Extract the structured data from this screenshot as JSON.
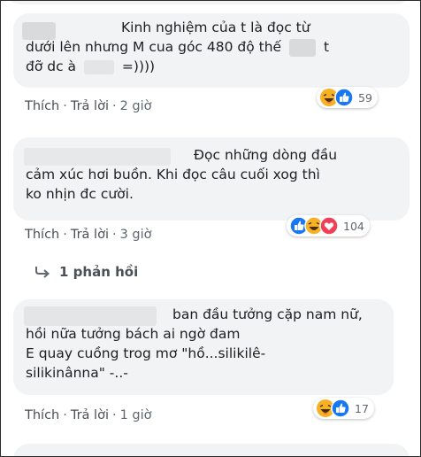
{
  "comments": [
    {
      "line1": "Kinh nghiệm của t là đọc từ",
      "line2_pre": "dưới lên nhưng M cua góc 480 độ thế",
      "line2_post": "t",
      "line3_pre": "đỡ dc à",
      "line3_post": "=))))",
      "like": "Thích",
      "reply": "Trả lời",
      "time": "2 giờ",
      "reaction_count": "59"
    },
    {
      "line1": "Đọc những dòng đầu",
      "line2": "cảm xúc hơi buồn. Khi đọc câu cuối xog thì",
      "line3": "ko nhịn đc cười.",
      "like": "Thích",
      "reply": "Trả lời",
      "time": "3 giờ",
      "reaction_count": "104"
    },
    {
      "line1": "ban đầu tưởng cặp nam nữ,",
      "line2": "hồi nữa tưởng bách ai ngờ đam",
      "line3": "E quay cuồng trog mơ \"hồ...silikilê-",
      "line4": "silikinânna\" -..-",
      "like": "Thích",
      "reply": "Trả lời",
      "time": "1 giờ",
      "reaction_count": "17"
    }
  ],
  "replies_label": "1 phản hồi",
  "separator": "·",
  "colors": {
    "bubble": "#f2f3f5",
    "like_blue": "#1877f2",
    "haha_yellow": "#f7b125",
    "love_red": "#f33e58",
    "meta_gray": "#606770"
  },
  "icons": [
    "haha-icon",
    "like-icon",
    "love-icon",
    "reply-arrow-icon"
  ]
}
